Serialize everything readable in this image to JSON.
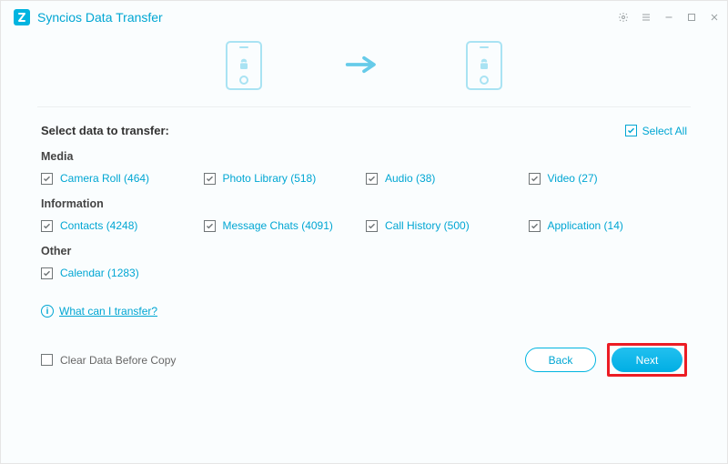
{
  "app_title": "Syncios Data Transfer",
  "heading": "Select data to transfer:",
  "select_all_label": "Select All",
  "sections": {
    "media": {
      "title": "Media",
      "items": [
        {
          "label": "Camera Roll (464)"
        },
        {
          "label": "Photo Library (518)"
        },
        {
          "label": "Audio (38)"
        },
        {
          "label": "Video (27)"
        }
      ]
    },
    "information": {
      "title": "Information",
      "items": [
        {
          "label": "Contacts (4248)"
        },
        {
          "label": "Message Chats (4091)"
        },
        {
          "label": "Call History (500)"
        },
        {
          "label": "Application (14)"
        }
      ]
    },
    "other": {
      "title": "Other",
      "items": [
        {
          "label": "Calendar (1283)"
        }
      ]
    }
  },
  "help_link": "What can I transfer?",
  "clear_data_label": "Clear Data Before Copy",
  "buttons": {
    "back": "Back",
    "next": "Next"
  }
}
